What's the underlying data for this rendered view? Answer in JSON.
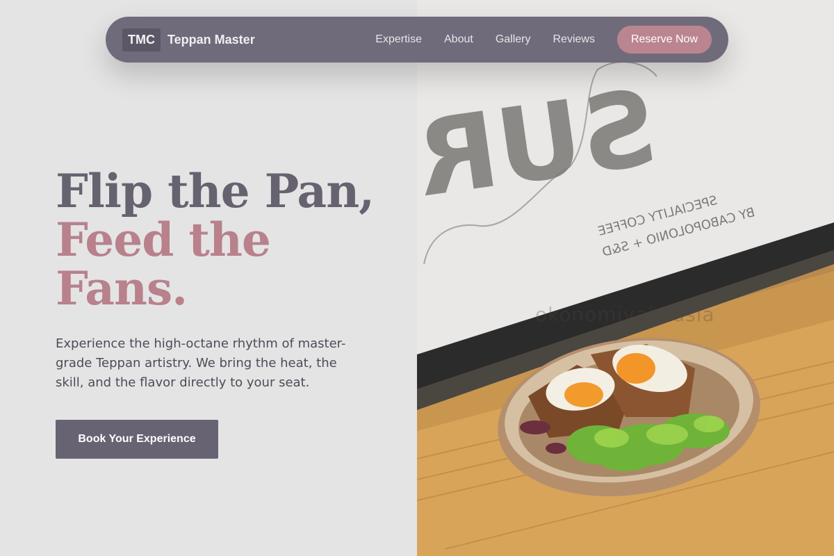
{
  "nav": {
    "logo": "TMC",
    "brand": "Teppan Master",
    "links": [
      "Expertise",
      "About",
      "Gallery",
      "Reviews"
    ],
    "cta": "Reserve Now"
  },
  "hero": {
    "title_line1": "Flip the Pan,",
    "title_line2": "Feed the",
    "title_line3": "Fans.",
    "subtitle": "Experience the high-octane rhythm of master-grade Teppan artistry. We bring the heat, the skill, and the flavor directly to your seat.",
    "button": "Book Your Experience"
  },
  "image": {
    "watermark": "okonomiyaki.asia",
    "window_text_main": "SUR",
    "window_text_small1": "SPECIALITY COFFEE",
    "window_text_small2": "BY CABOPOLONIO + S&D"
  },
  "colors": {
    "primary": "#686373",
    "accent": "#bb8590",
    "background": "#e4e4e5"
  }
}
